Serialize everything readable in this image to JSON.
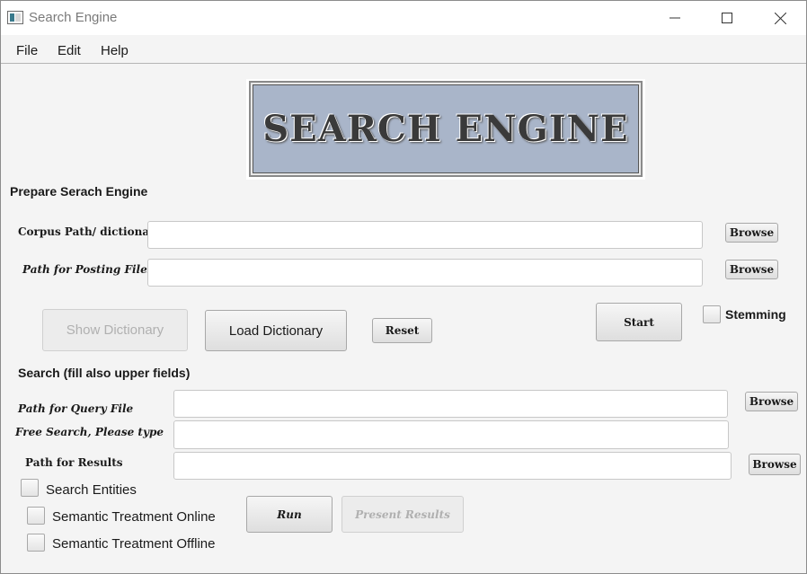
{
  "window": {
    "title": "Search Engine",
    "controls": [
      "minimize-icon",
      "maximize-icon",
      "close-icon"
    ]
  },
  "menu": {
    "items": [
      "File",
      "Edit",
      "Help"
    ]
  },
  "banner": {
    "text": "SEARCH ENGINE",
    "background": "#a9b5c9"
  },
  "prepare": {
    "heading": "Prepare Serach Engine",
    "corpus_label": "Corpus Path/ dictionary",
    "corpus_value": "",
    "corpus_browse": "Browse",
    "posting_label": "Path for Posting Files",
    "posting_value": "",
    "posting_browse": "Browse",
    "show_dictionary": "Show Dictionary",
    "load_dictionary": "Load Dictionary",
    "reset": "Reset",
    "start": "Start",
    "stemming": "Stemming",
    "stemming_checked": false
  },
  "search": {
    "heading": "Search (fill also upper fields)",
    "query_label": "Path for Query File",
    "query_value": "",
    "query_browse": "Browse",
    "free_label": "Free Search, Please type",
    "free_value": "",
    "results_label": "Path for Results",
    "results_value": "",
    "results_browse": "Browse",
    "entities": "Search Entities",
    "entities_checked": false,
    "semantic_online": "Semantic Treatment Online",
    "semantic_online_checked": false,
    "semantic_offline": "Semantic Treatment Offline",
    "semantic_offline_checked": false,
    "run": "Run",
    "present_results": "Present Results"
  }
}
